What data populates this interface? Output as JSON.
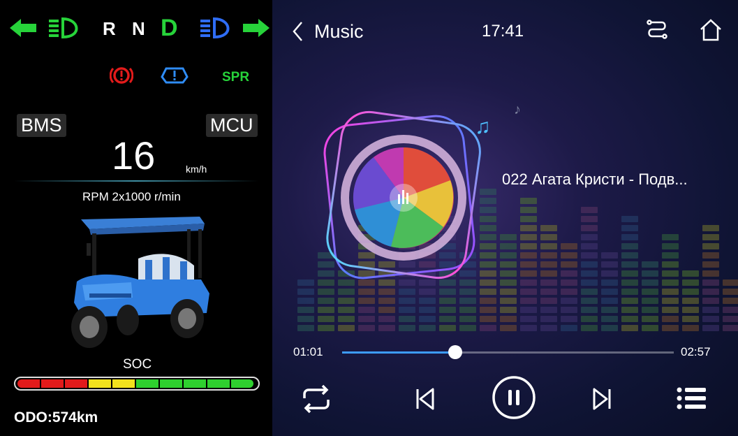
{
  "indicators": {
    "gears": [
      "R",
      "N",
      "D"
    ],
    "active_gear": "D",
    "warnings": [
      "brake-warning-icon",
      "tire-pressure-warning-icon",
      "SPR"
    ],
    "spr_label": "SPR"
  },
  "dashboard": {
    "bms_label": "BMS",
    "mcu_label": "MCU",
    "speed": "16",
    "speed_unit": "km/h",
    "rpm_label": "RPM 2x1000 r/min",
    "soc_label": "SOC",
    "soc_segments": [
      "red",
      "red",
      "red",
      "yellow",
      "yellow",
      "green",
      "green",
      "green",
      "green",
      "green"
    ],
    "odo": "ODO:574km"
  },
  "header": {
    "back_label": "Music",
    "time": "17:41"
  },
  "player": {
    "track_title": "022 Агата Кристи - Подв...",
    "elapsed": "01:01",
    "duration": "02:57",
    "progress": 0.34
  },
  "colors": {
    "green": "#27d33a",
    "blue": "#2f6df5",
    "red": "#e21b1b",
    "accent": "#3d9cff"
  }
}
